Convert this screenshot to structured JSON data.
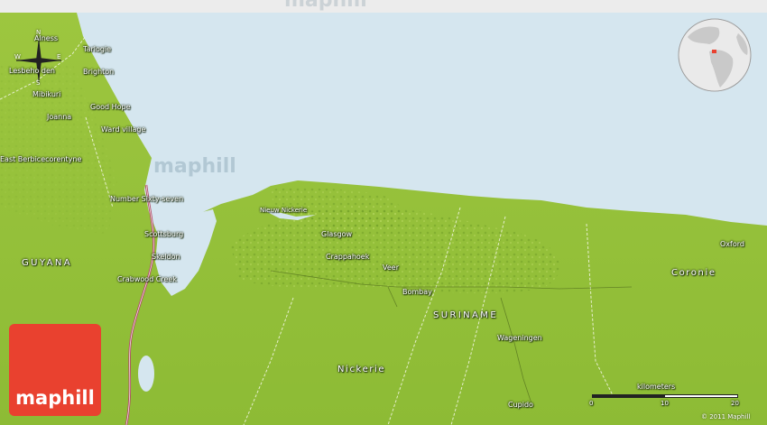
{
  "map": {
    "colors": {
      "water": "#d5e6ef",
      "land": "#98c33d",
      "land_dark": "#6fa12a",
      "river": "#b04a64",
      "road": "#f4f7e6",
      "badge": "#e9412f"
    },
    "watermark": "maphill",
    "brand": "maphill",
    "copyright": "© 2011 Maphill",
    "compass": {
      "n": "N",
      "s": "S",
      "e": "E",
      "w": "W"
    },
    "scale": {
      "title": "kilometers",
      "ticks": [
        "0",
        "10",
        "20"
      ]
    },
    "places": {
      "alness": "Alness",
      "tarlogie": "Tarlogie",
      "lesbeholden": "Lesbeho den",
      "brighton": "Brighton",
      "mibikuri": "Mibikuri",
      "good_hope": "Good Hope",
      "joanna": "Joanna",
      "ward_village": "Ward village",
      "east_berbice": "East Berbicecorentyne",
      "number_sixty_seven": "Number Sixty-seven",
      "scottsburg": "Scottsburg",
      "skeldon": "Skeldon",
      "crabwood_creek": "Crabwood Creek",
      "nieuw_nickerie": "Nieuw Nickerie",
      "glasgow": "Glasgow",
      "crappahoek": "Crappahoek",
      "veer": "Veer",
      "bombay": "Bombay",
      "wageningen": "Wageningen",
      "cupido": "Cupido",
      "oxford": "Oxford"
    },
    "regions": {
      "guyana": "GUYANA",
      "suriname": "SURINAME",
      "nickerie": "Nickerie",
      "coronie": "Coronie"
    }
  }
}
